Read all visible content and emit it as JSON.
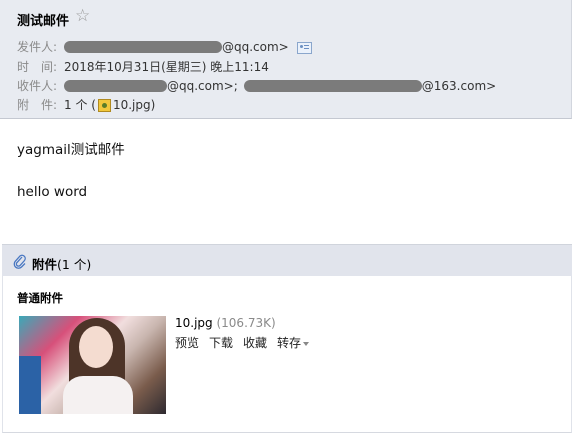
{
  "email": {
    "subject": "测试邮件",
    "sender_label": "发件人:",
    "sender_suffix": "@qq.com>",
    "time_label": "时　间:",
    "time_value": "2018年10月31日(星期三) 晚上11:14",
    "recipient_label": "收件人:",
    "recipient_1_suffix": "@qq.com>;",
    "recipient_2_suffix": "@163.com>",
    "attach_label": "附　件:",
    "attach_count": "1 个 (",
    "attach_file": "10.jpg",
    "attach_close": ")"
  },
  "body": {
    "line1": "yagmail测试邮件",
    "line2": "hello word"
  },
  "attachments": {
    "title": "附件",
    "count": "(1 个)",
    "group": "普通附件",
    "file_name": "10.jpg",
    "file_size": "(106.73K)",
    "actions": {
      "preview": "预览",
      "download": "下载",
      "save": "收藏",
      "forward": "转存"
    }
  }
}
